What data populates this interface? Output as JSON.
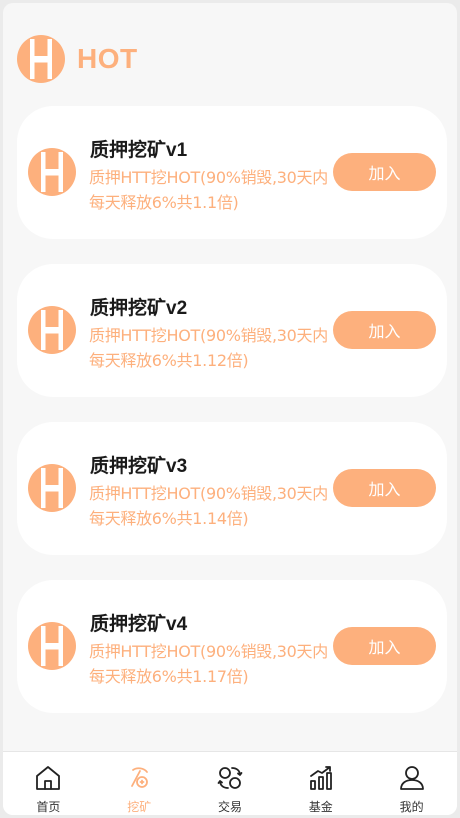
{
  "colors": {
    "accent": "#fdb07d",
    "background": "#f7f7f7",
    "card": "#ffffff",
    "title": "#1a1a1a"
  },
  "header": {
    "brand_text": "HOT",
    "logo_icon": "hot-coin-logo-icon"
  },
  "pools": [
    {
      "title": "质押挖矿v1",
      "description": "质押HTT挖HOT(90%销毁,30天内每天释放6%共1.1倍)",
      "join_label": "加入"
    },
    {
      "title": "质押挖矿v2",
      "description": "质押HTT挖HOT(90%销毁,30天内每天释放6%共1.12倍)",
      "join_label": "加入"
    },
    {
      "title": "质押挖矿v3",
      "description": "质押HTT挖HOT(90%销毁,30天内每天释放6%共1.14倍)",
      "join_label": "加入"
    },
    {
      "title": "质押挖矿v4",
      "description": "质押HTT挖HOT(90%销毁,30天内每天释放6%共1.17倍)",
      "join_label": "加入"
    }
  ],
  "tabbar": {
    "items": [
      {
        "label": "首页",
        "icon": "home-icon"
      },
      {
        "label": "挖矿",
        "icon": "mining-icon",
        "active": true
      },
      {
        "label": "交易",
        "icon": "exchange-icon"
      },
      {
        "label": "基金",
        "icon": "fund-chart-icon"
      },
      {
        "label": "我的",
        "icon": "profile-icon"
      }
    ]
  }
}
